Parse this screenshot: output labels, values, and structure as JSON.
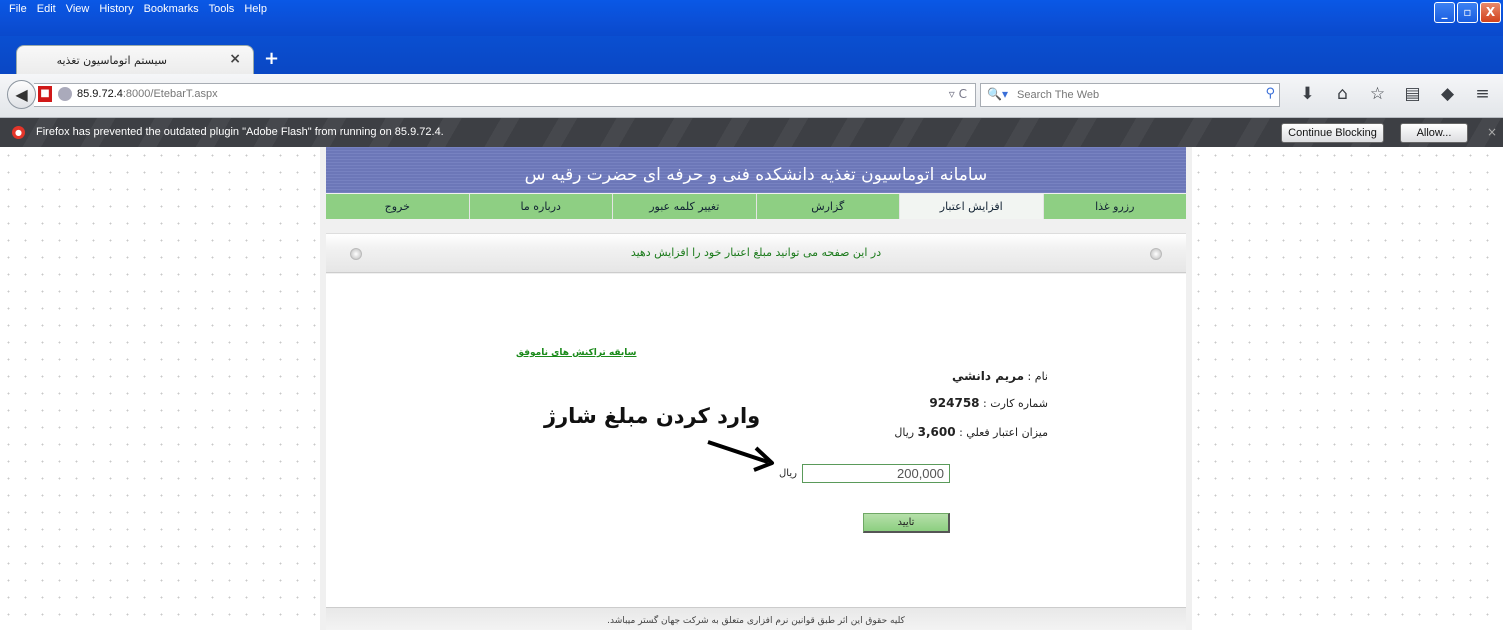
{
  "browser": {
    "menu": [
      "File",
      "Edit",
      "View",
      "History",
      "Bookmarks",
      "Tools",
      "Help"
    ],
    "window_buttons": {
      "minimize": "_",
      "maximize": "▫",
      "close": "X"
    },
    "tab": {
      "title": "سیستم اتوماسیون تغذیه",
      "close": "×"
    },
    "new_tab": "+",
    "url": {
      "host": "85.9.72.4",
      "rest": ":8000/EtebarT.aspx"
    },
    "search": {
      "placeholder": "Search The Web"
    },
    "notification": {
      "text": "Firefox has prevented the outdated plugin \"Adobe Flash\" from running on 85.9.72.4.",
      "continue_label": "Continue Blocking",
      "allow_label": "Allow..."
    }
  },
  "site": {
    "header_title": "سامانه اتوماسیون تغذیه دانشکده فنی و حرفه ای حضرت رقیه س",
    "nav": [
      {
        "label": "رزرو غذا"
      },
      {
        "label": "افزایش اعتبار"
      },
      {
        "label": "گزارش"
      },
      {
        "label": "تغییر کلمه عبور"
      },
      {
        "label": "درباره ما"
      },
      {
        "label": "خروج"
      }
    ],
    "info_text": "در این صفحه می توانید مبلغ اعتبار خود را افزایش دهید",
    "history_link": "سابقه تراکنش های ناموفق",
    "name_label": "نام : ",
    "name_value": "مريم دانشي",
    "card_label": "شماره کارت : ",
    "card_value": "924758",
    "credit_label": "ميزان اعتبار فعلي : ",
    "credit_value": "3,600",
    "credit_unit": " ريال",
    "annotation": "وارد کردن مبلغ شارژ",
    "amount_value": "200,000",
    "amount_unit": "ريال",
    "confirm_label": "تاييد",
    "footer": "کلیه حقوق این اثر طبق قوانین نرم افزاری متعلق به شرکت جهان گستر میباشد."
  }
}
